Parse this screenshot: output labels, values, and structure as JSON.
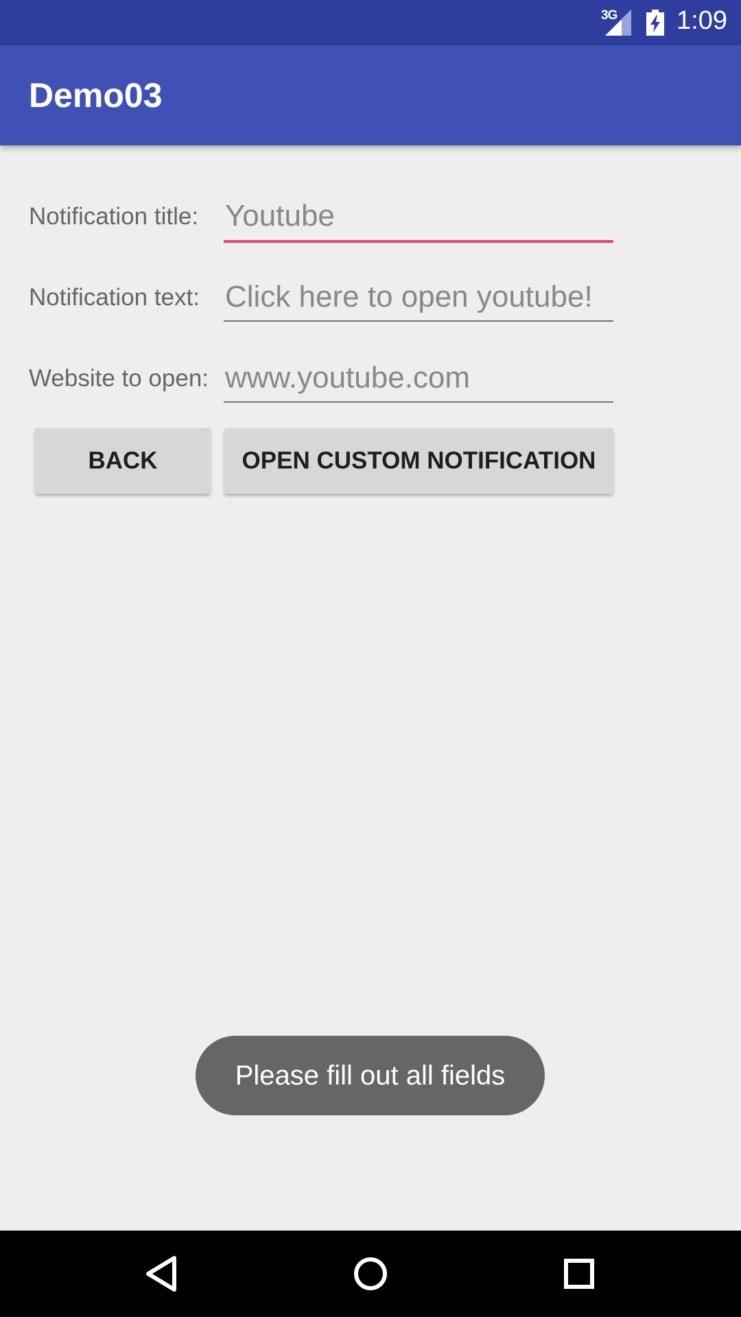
{
  "status_bar": {
    "network_type": "3G",
    "time": "1:09",
    "icons": [
      "signal-icon",
      "battery-charging-icon"
    ]
  },
  "app_bar": {
    "title": "Demo03"
  },
  "form": {
    "title_label": "Notification title:",
    "title_value": "",
    "title_placeholder": "Youtube",
    "text_label": "Notification text:",
    "text_value": "",
    "text_placeholder": "Click here to open youtube!",
    "website_label": "Website to open:",
    "website_value": "",
    "website_placeholder": "www.youtube.com"
  },
  "buttons": {
    "back_label": "BACK",
    "open_label": "OPEN CUSTOM NOTIFICATION"
  },
  "toast": {
    "message": "Please fill out all fields"
  },
  "nav_bar": {
    "icons": [
      "back-triangle-icon",
      "home-circle-icon",
      "recents-square-icon"
    ]
  },
  "colors": {
    "status_bar": "#2f3e9e",
    "app_bar": "#3f51b5",
    "focus_accent": "#ec407a",
    "background": "#eeeeee"
  }
}
